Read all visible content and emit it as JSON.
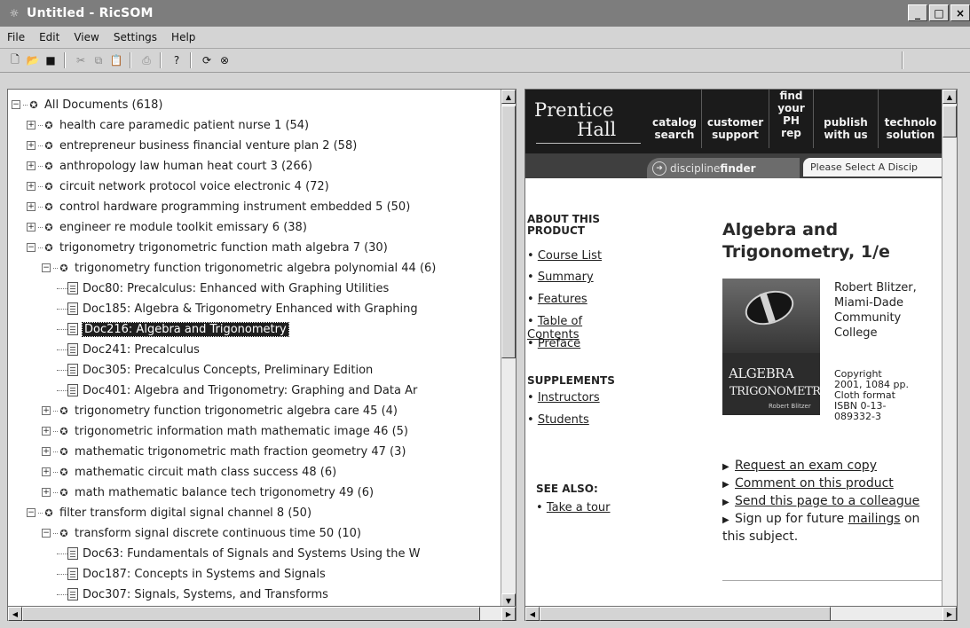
{
  "window": {
    "title": "Untitled - RicSOM",
    "app_icon": "ricsom-app-icon",
    "controls": [
      "_",
      "□",
      "×"
    ]
  },
  "menu": [
    "File",
    "Edit",
    "View",
    "Settings",
    "Help"
  ],
  "toolbar": {
    "icons": [
      "new-document-icon",
      "open-folder-icon",
      "save-icon",
      "cut-icon",
      "copy-icon",
      "paste-icon",
      "print-icon",
      "help-icon",
      "refresh-icon",
      "stop-icon"
    ]
  },
  "tree": [
    {
      "label": "All Documents (618)",
      "level": 0,
      "type": "cluster",
      "expander": "minus"
    },
    {
      "label": "health care paramedic patient nurse 1 (54)",
      "level": 1,
      "type": "cluster",
      "expander": "plus"
    },
    {
      "label": "entrepreneur business financial venture plan 2 (58)",
      "level": 1,
      "type": "cluster",
      "expander": "plus"
    },
    {
      "label": "anthropology law human heat court 3 (266)",
      "level": 1,
      "type": "cluster",
      "expander": "plus"
    },
    {
      "label": "circuit network protocol voice electronic 4 (72)",
      "level": 1,
      "type": "cluster",
      "expander": "plus"
    },
    {
      "label": "control hardware programming instrument embedded 5 (50)",
      "level": 1,
      "type": "cluster",
      "expander": "plus"
    },
    {
      "label": "engineer re module toolkit emissary 6 (38)",
      "level": 1,
      "type": "cluster",
      "expander": "plus"
    },
    {
      "label": "trigonometry trigonometric function math algebra 7 (30)",
      "level": 1,
      "type": "cluster",
      "expander": "minus"
    },
    {
      "label": "trigonometry function trigonometric algebra polynomial 44 (6)",
      "level": 2,
      "type": "cluster",
      "expander": "minus"
    },
    {
      "label": "Doc80: Precalculus: Enhanced with Graphing Utilities",
      "level": 3,
      "type": "doc"
    },
    {
      "label": "Doc185: Algebra & Trigonometry Enhanced with Graphing",
      "level": 3,
      "type": "doc"
    },
    {
      "label": "Doc216: Algebra and Trigonometry",
      "level": 3,
      "type": "doc",
      "selected": true
    },
    {
      "label": "Doc241: Precalculus",
      "level": 3,
      "type": "doc"
    },
    {
      "label": "Doc305: Precalculus Concepts, Preliminary Edition",
      "level": 3,
      "type": "doc"
    },
    {
      "label": "Doc401: Algebra and Trigonometry: Graphing and Data Ar",
      "level": 3,
      "type": "doc"
    },
    {
      "label": "trigonometry function trigonometric algebra care 45 (4)",
      "level": 2,
      "type": "cluster",
      "expander": "plus"
    },
    {
      "label": "trigonometric information math mathematic image 46 (5)",
      "level": 2,
      "type": "cluster",
      "expander": "plus"
    },
    {
      "label": "mathematic trigonometric math fraction geometry 47 (3)",
      "level": 2,
      "type": "cluster",
      "expander": "plus"
    },
    {
      "label": "mathematic circuit math class success 48 (6)",
      "level": 2,
      "type": "cluster",
      "expander": "plus"
    },
    {
      "label": "math mathematic balance tech trigonometry 49 (6)",
      "level": 2,
      "type": "cluster",
      "expander": "plus"
    },
    {
      "label": "filter transform digital signal channel 8 (50)",
      "level": 1,
      "type": "cluster",
      "expander": "minus"
    },
    {
      "label": "transform signal discrete continuous time 50 (10)",
      "level": 2,
      "type": "cluster",
      "expander": "minus"
    },
    {
      "label": "Doc63: Fundamentals of Signals and Systems Using the W",
      "level": 3,
      "type": "doc"
    },
    {
      "label": "Doc187: Concepts in Systems and Signals",
      "level": 3,
      "type": "doc"
    },
    {
      "label": "Doc307: Signals, Systems, and Transforms",
      "level": 3,
      "type": "doc"
    }
  ],
  "web": {
    "logo_line1": "Prentice",
    "logo_line2": "Hall",
    "nav": [
      "catalog\nsearch",
      "customer\nsupport",
      "find\nyour\nPH\nrep",
      "publish\nwith us",
      "technolo\nsolution"
    ],
    "finder_prefix": "discipline",
    "finder_bold": "finder",
    "finder_arrow": "➜",
    "select_placeholder": "Please Select A Discip",
    "about_title": "ABOUT THIS\nPRODUCT",
    "about_links": [
      "Course List",
      "Summary",
      "Features",
      "Table of Contents",
      "Preface"
    ],
    "supplements_title": "SUPPLEMENTS",
    "supplement_links": [
      "Instructors",
      "Students"
    ],
    "seealso_title": "SEE ALSO:",
    "seealso_links": [
      "Take a tour"
    ],
    "product_title": "Algebra and\nTrigonometry, 1/e",
    "cover_text1": "ALGEBRA",
    "cover_text2": "TRIGONOMETRY",
    "cover_author": "Robert Blitzer",
    "author": "Robert Blitzer,\nMiami-Dade\nCommunity\nCollege",
    "copyright": "Copyright\n2001, 1084 pp.\nCloth format\nISBN 0-13-\n089332-3",
    "actions": [
      {
        "link": "Request an exam copy",
        "suffix": ""
      },
      {
        "link": "Comment on this product",
        "suffix": ""
      },
      {
        "link": "Send this page to a colleague",
        "suffix": ""
      },
      {
        "prefix": "Sign up for future ",
        "link": "mailings",
        "suffix": " on this subject."
      }
    ]
  }
}
